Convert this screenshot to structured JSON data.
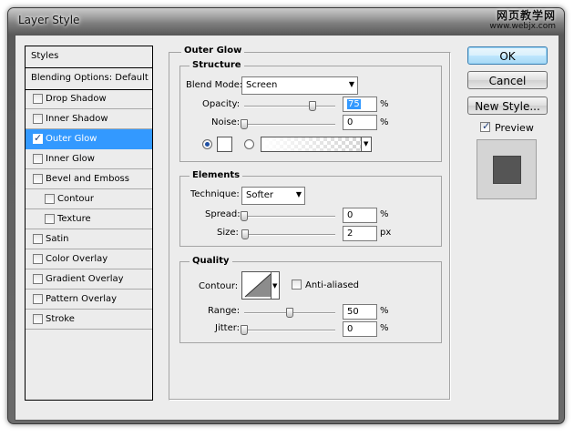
{
  "window": {
    "title": "Layer Style",
    "watermark_line1": "网页教学网",
    "watermark_line2": "www.webjx.com"
  },
  "styles_list": {
    "header": "Styles",
    "blending": "Blending Options: Default",
    "items": [
      {
        "label": "Drop Shadow",
        "checked": false,
        "indent": false
      },
      {
        "label": "Inner Shadow",
        "checked": false,
        "indent": false
      },
      {
        "label": "Outer Glow",
        "checked": true,
        "indent": false,
        "selected": true
      },
      {
        "label": "Inner Glow",
        "checked": false,
        "indent": false
      },
      {
        "label": "Bevel and Emboss",
        "checked": false,
        "indent": false
      },
      {
        "label": "Contour",
        "checked": false,
        "indent": true
      },
      {
        "label": "Texture",
        "checked": false,
        "indent": true
      },
      {
        "label": "Satin",
        "checked": false,
        "indent": false
      },
      {
        "label": "Color Overlay",
        "checked": false,
        "indent": false
      },
      {
        "label": "Gradient Overlay",
        "checked": false,
        "indent": false
      },
      {
        "label": "Pattern Overlay",
        "checked": false,
        "indent": false
      },
      {
        "label": "Stroke",
        "checked": false,
        "indent": false
      }
    ]
  },
  "panel": {
    "title": "Outer Glow",
    "structure": {
      "title": "Structure",
      "blend_mode_label": "Blend Mode:",
      "blend_mode_value": "Screen",
      "opacity_label": "Opacity:",
      "opacity_value": "75",
      "opacity_fraction": 0.75,
      "noise_label": "Noise:",
      "noise_value": "0",
      "noise_fraction": 0,
      "percent": "%"
    },
    "elements": {
      "title": "Elements",
      "technique_label": "Technique:",
      "technique_value": "Softer",
      "spread_label": "Spread:",
      "spread_value": "0",
      "spread_fraction": 0,
      "size_label": "Size:",
      "size_value": "2",
      "size_fraction": 0.01,
      "percent": "%",
      "px": "px"
    },
    "quality": {
      "title": "Quality",
      "contour_label": "Contour:",
      "anti_aliased_label": "Anti-aliased",
      "range_label": "Range:",
      "range_value": "50",
      "range_fraction": 0.5,
      "jitter_label": "Jitter:",
      "jitter_value": "0",
      "jitter_fraction": 0,
      "percent": "%"
    }
  },
  "buttons": {
    "ok": "OK",
    "cancel": "Cancel",
    "new_style": "New Style...",
    "preview_label": "Preview",
    "preview_checked": true
  },
  "colors": {
    "selection": "#3399ff",
    "dialog_bg": "#ececec",
    "preview_swatch": "#555555"
  }
}
